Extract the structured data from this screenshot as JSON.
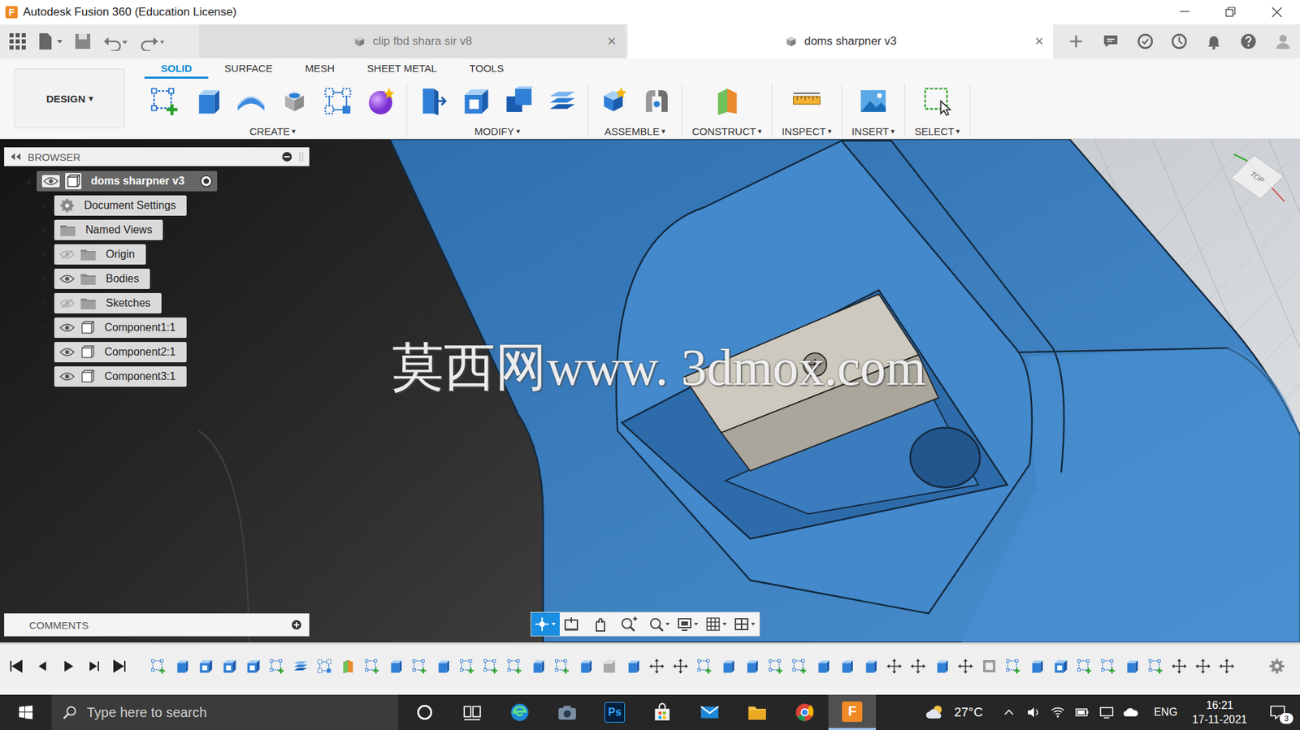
{
  "window": {
    "title": "Autodesk Fusion 360 (Education License)",
    "app_icon": "F"
  },
  "doc_tabs": [
    {
      "label": "clip fbd shara sir v8",
      "close": "×",
      "selected": false
    },
    {
      "label": "doms sharpner v3",
      "close": "×",
      "selected": true
    }
  ],
  "workspace": {
    "label": "DESIGN",
    "arrow": "▾"
  },
  "ribbon_tabs": [
    {
      "label": "SOLID",
      "selected": true
    },
    {
      "label": "SURFACE",
      "selected": false
    },
    {
      "label": "MESH",
      "selected": false
    },
    {
      "label": "SHEET METAL",
      "selected": false
    },
    {
      "label": "TOOLS",
      "selected": false
    }
  ],
  "tool_groups": [
    {
      "label": "CREATE",
      "arrow": "▾",
      "tools": [
        "sketch",
        "extrude",
        "revolve",
        "hole",
        "pattern",
        "form"
      ]
    },
    {
      "label": "MODIFY",
      "arrow": "▾",
      "tools": [
        "presspull",
        "fillet",
        "combine",
        "layers"
      ]
    },
    {
      "label": "ASSEMBLE",
      "arrow": "▾",
      "tools": [
        "newcomp",
        "joint"
      ]
    },
    {
      "label": "CONSTRUCT",
      "arrow": "▾",
      "tools": [
        "plane"
      ]
    },
    {
      "label": "INSPECT",
      "arrow": "▾",
      "tools": [
        "measure"
      ]
    },
    {
      "label": "INSERT",
      "arrow": "▾",
      "tools": [
        "image"
      ]
    },
    {
      "label": "SELECT",
      "arrow": "▾",
      "tools": [
        "select"
      ]
    }
  ],
  "browser": {
    "title": "BROWSER",
    "items": [
      {
        "label": "doms sharpner v3",
        "kind": "root",
        "expanded": true,
        "visible": true
      },
      {
        "label": "Document Settings",
        "kind": "settings",
        "expanded": false
      },
      {
        "label": "Named Views",
        "kind": "folder",
        "expanded": false
      },
      {
        "label": "Origin",
        "kind": "folder",
        "expanded": false,
        "visible": false
      },
      {
        "label": "Bodies",
        "kind": "folder",
        "expanded": false,
        "visible": true
      },
      {
        "label": "Sketches",
        "kind": "folder",
        "expanded": false,
        "visible": false
      },
      {
        "label": "Component1:1",
        "kind": "component",
        "expanded": false,
        "visible": true
      },
      {
        "label": "Component2:1",
        "kind": "component",
        "expanded": false,
        "visible": true
      },
      {
        "label": "Component3:1",
        "kind": "component",
        "expanded": false,
        "visible": true
      }
    ]
  },
  "comments": {
    "title": "COMMENTS"
  },
  "watermark": "莫西网www. 3dmox.com",
  "viewcube": {
    "face": "TOP"
  },
  "nav_tools": [
    {
      "kind": "orbit",
      "selected": true
    },
    {
      "kind": "lookat",
      "selected": false
    },
    {
      "kind": "pan",
      "selected": false
    },
    {
      "kind": "zoom",
      "selected": false
    },
    {
      "kind": "fit",
      "selected": false
    },
    {
      "kind": "display",
      "selected": false
    },
    {
      "kind": "grid",
      "selected": false
    },
    {
      "kind": "viewports",
      "selected": false
    }
  ],
  "timeline": {
    "features": [
      "sketch",
      "extrude",
      "fillet",
      "fillet",
      "fillet",
      "sketch",
      "layers",
      "pattern",
      "plane",
      "sketch",
      "extrude",
      "sketch",
      "extrude",
      "sketch",
      "sketch",
      "sketch",
      "extrude",
      "sketch",
      "extrude",
      "chamfer",
      "extrude",
      "move",
      "move",
      "sketch",
      "extrude",
      "extrude",
      "sketch",
      "sketch",
      "extrude",
      "extrude",
      "extrude",
      "move",
      "move",
      "extrude",
      "move",
      "shell",
      "sketch",
      "extrude",
      "fillet",
      "sketch",
      "sketch",
      "extrude",
      "sketch",
      "move",
      "move",
      "move"
    ]
  },
  "taskbar": {
    "search_placeholder": "Type here to search",
    "apps": [
      {
        "kind": "cortana",
        "selected": false
      },
      {
        "kind": "taskview",
        "selected": false
      },
      {
        "kind": "edge",
        "selected": false
      },
      {
        "kind": "camera",
        "selected": false
      },
      {
        "kind": "photoshop",
        "label": "Ps",
        "selected": false
      },
      {
        "kind": "store",
        "selected": false
      },
      {
        "kind": "mail",
        "selected": false
      },
      {
        "kind": "explorer",
        "selected": false
      },
      {
        "kind": "chrome",
        "selected": false
      },
      {
        "kind": "fusion",
        "label": "F",
        "selected": true
      }
    ],
    "weather": "27°C",
    "language": "ENG",
    "time": "16:21",
    "date": "17-11-2021",
    "notifications": "3"
  }
}
